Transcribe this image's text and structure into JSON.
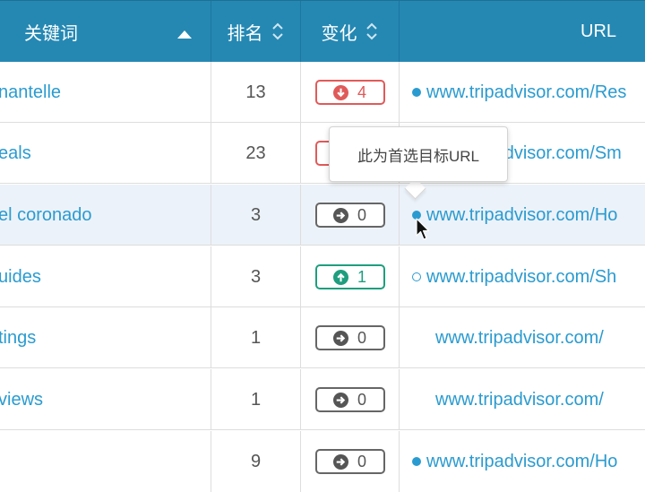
{
  "header": {
    "keyword_label": "关键词",
    "rank_label": "排名",
    "change_label": "变化",
    "url_label": "URL"
  },
  "colors": {
    "header_bg": "#2588b3",
    "link": "#2a9bd0",
    "down": "#e05a5a",
    "up": "#1e9e7e",
    "neutral": "#666666",
    "highlight_row": "#ecf2f9"
  },
  "rows": [
    {
      "keyword": "nantelle",
      "rank": "13",
      "change": "4",
      "direction": "down",
      "url": "www.tripadvisor.com/Res",
      "marker": "filled"
    },
    {
      "keyword": "eals",
      "rank": "23",
      "change": "",
      "direction": "down",
      "url": "www.tripadvisor.com/Sm",
      "marker": "filled"
    },
    {
      "keyword": "el coronado",
      "rank": "3",
      "change": "0",
      "direction": "same",
      "url": "www.tripadvisor.com/Ho",
      "marker": "filled"
    },
    {
      "keyword": "uides",
      "rank": "3",
      "change": "1",
      "direction": "up",
      "url": "www.tripadvisor.com/Sh",
      "marker": "empty"
    },
    {
      "keyword": "tings",
      "rank": "1",
      "change": "0",
      "direction": "same",
      "url": "www.tripadvisor.com/",
      "marker": "none"
    },
    {
      "keyword": "views",
      "rank": "1",
      "change": "0",
      "direction": "same",
      "url": "www.tripadvisor.com/",
      "marker": "none"
    },
    {
      "keyword": "",
      "rank": "9",
      "change": "0",
      "direction": "same",
      "url": "www.tripadvisor.com/Ho",
      "marker": "filled"
    }
  ],
  "tooltip": {
    "text": "此为首选目标URL"
  },
  "icons": {
    "sort_asc": "caret-up-icon",
    "sort_both": "sort-icon",
    "down": "arrow-down-circle-icon",
    "up": "arrow-up-circle-icon",
    "same": "arrow-right-circle-icon",
    "cursor": "mouse-pointer-icon"
  }
}
